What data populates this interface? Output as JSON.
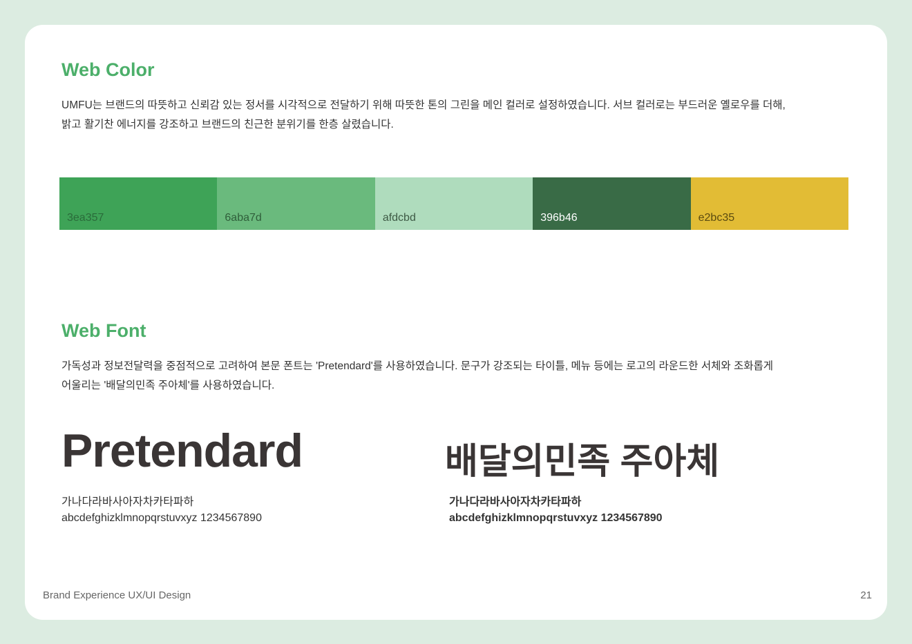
{
  "color_section": {
    "title": "Web Color",
    "desc1": "UMFU는 브랜드의 따뜻하고 신뢰감 있는 정서를 시각적으로 전달하기 위해 따뜻한 톤의 그린을 메인 컬러로 설정하였습니다. 서브 컬러로는 부드러운 옐로우를 더해,",
    "desc2": "밝고 활기찬 에너지를 강조하고 브랜드의 친근한 분위기를 한층 살렸습니다.",
    "swatches": [
      {
        "label": "3ea357",
        "color": "#3ea357",
        "text": "#2a6b3a"
      },
      {
        "label": "6aba7d",
        "color": "#6aba7d",
        "text": "#2f5e3a"
      },
      {
        "label": "afdcbd",
        "color": "#afdcbd",
        "text": "#3e5a45"
      },
      {
        "label": "396b46",
        "color": "#396b46",
        "text": "#ffffff"
      },
      {
        "label": "e2bc35",
        "color": "#e2bc35",
        "text": "#5a4a10"
      }
    ]
  },
  "font_section": {
    "title": "Web Font",
    "desc1": "가독성과 정보전달력을 중점적으로 고려하여 본문 폰트는 'Pretendard'를 사용하였습니다. 문구가 강조되는 타이틀, 메뉴 등에는 로고의 라운드한 서체와 조화롭게",
    "desc2": "어울리는 '배달의민족 주아체'를 사용하였습니다.",
    "fonts": [
      {
        "name": "Pretendard",
        "hangul": "가나다라바사아자차카타파하",
        "latin": "abcdefghizklmnopqrstuvxyz 1234567890"
      },
      {
        "name": "배달의민족 주아체",
        "hangul": "가나다라바사아자차카타파하",
        "latin": "abcdefghizklmnopqrstuvxyz 1234567890"
      }
    ]
  },
  "footer": {
    "left": "Brand Experience UX/UI Design",
    "page": "21"
  }
}
